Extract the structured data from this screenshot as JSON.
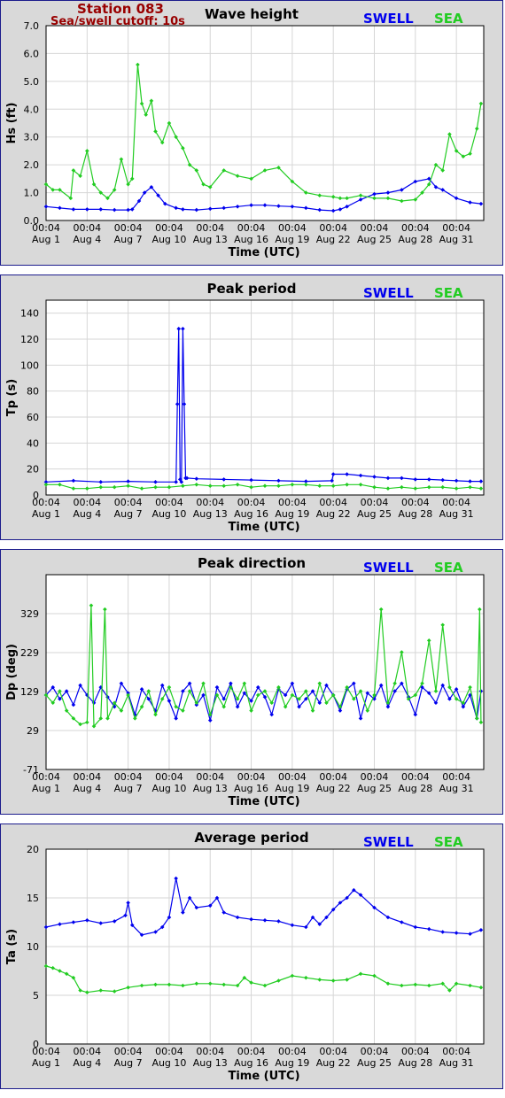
{
  "header": {
    "station": "Station 083",
    "cutoff": "Sea/swell cutoff: 10s"
  },
  "colors": {
    "swell": "#0000ee",
    "sea": "#22cc22",
    "header": "#990000",
    "frame": "#1c1c8c"
  },
  "legend": {
    "swell": "SWELL",
    "sea": "SEA"
  },
  "chart_data": [
    {
      "type": "line",
      "title": "Wave height",
      "xlabel": "Time (UTC)",
      "ylabel": "Hs (ft)",
      "xtick_time": "00:04",
      "xtick_dates": [
        "Aug 1",
        "Aug 4",
        "Aug 7",
        "Aug 10",
        "Aug 13",
        "Aug 16",
        "Aug 19",
        "Aug 22",
        "Aug 25",
        "Aug 28",
        "Aug 31"
      ],
      "yticks": [
        "0.0",
        "1.0",
        "2.0",
        "3.0",
        "4.0",
        "5.0",
        "6.0",
        "7.0"
      ],
      "ylim": [
        0,
        7
      ],
      "xlim": [
        1,
        33
      ],
      "grid": true,
      "legend": "top-right",
      "series": [
        {
          "name": "SWELL",
          "x": [
            1,
            2,
            3,
            4,
            5,
            6,
            7,
            7.3,
            7.8,
            8.2,
            8.7,
            9.2,
            9.7,
            10.5,
            11,
            12,
            13,
            14,
            15,
            16,
            17,
            18,
            19,
            20,
            21,
            22,
            22.5,
            23,
            24,
            25,
            26,
            27,
            28,
            29,
            29.5,
            30,
            31,
            32,
            32.8
          ],
          "y": [
            0.5,
            0.45,
            0.4,
            0.4,
            0.4,
            0.38,
            0.38,
            0.4,
            0.7,
            1.0,
            1.2,
            0.9,
            0.6,
            0.45,
            0.4,
            0.38,
            0.42,
            0.45,
            0.5,
            0.55,
            0.55,
            0.52,
            0.5,
            0.45,
            0.38,
            0.35,
            0.4,
            0.5,
            0.75,
            0.95,
            1.0,
            1.1,
            1.4,
            1.5,
            1.2,
            1.1,
            0.8,
            0.65,
            0.6
          ]
        },
        {
          "name": "SEA",
          "x": [
            1,
            1.5,
            2,
            2.8,
            3,
            3.5,
            4,
            4.5,
            5,
            5.5,
            6,
            6.5,
            7,
            7.3,
            7.7,
            8,
            8.3,
            8.7,
            9,
            9.5,
            10,
            10.5,
            11,
            11.5,
            12,
            12.5,
            13,
            14,
            15,
            16,
            17,
            18,
            19,
            20,
            21,
            22,
            22.5,
            23,
            24,
            25,
            26,
            27,
            28,
            28.5,
            29,
            29.5,
            30,
            30.5,
            31,
            31.5,
            32,
            32.5,
            32.8
          ],
          "y": [
            1.3,
            1.1,
            1.1,
            0.8,
            1.8,
            1.6,
            2.5,
            1.3,
            1.0,
            0.8,
            1.1,
            2.2,
            1.3,
            1.5,
            5.6,
            4.2,
            3.8,
            4.3,
            3.2,
            2.8,
            3.5,
            3.0,
            2.6,
            2.0,
            1.8,
            1.3,
            1.2,
            1.8,
            1.6,
            1.5,
            1.8,
            1.9,
            1.4,
            1.0,
            0.9,
            0.85,
            0.8,
            0.8,
            0.9,
            0.8,
            0.8,
            0.7,
            0.75,
            1.0,
            1.3,
            2.0,
            1.8,
            3.1,
            2.5,
            2.3,
            2.4,
            3.3,
            4.2
          ]
        }
      ]
    },
    {
      "type": "line",
      "title": "Peak period",
      "xlabel": "Time (UTC)",
      "ylabel": "Tp (s)",
      "xtick_time": "00:04",
      "xtick_dates": [
        "Aug 1",
        "Aug 4",
        "Aug 7",
        "Aug 10",
        "Aug 13",
        "Aug 16",
        "Aug 19",
        "Aug 22",
        "Aug 25",
        "Aug 28",
        "Aug 31"
      ],
      "yticks": [
        "0",
        "20",
        "40",
        "60",
        "80",
        "100",
        "120",
        "140"
      ],
      "ylim": [
        0,
        150
      ],
      "xlim": [
        1,
        33
      ],
      "grid": true,
      "legend": "top-right",
      "series": [
        {
          "name": "SWELL",
          "x": [
            1,
            3,
            5,
            7,
            9,
            10.5,
            10.6,
            10.7,
            10.8,
            10.9,
            11.0,
            11.1,
            11.2,
            11.3,
            12,
            14,
            16,
            18,
            20,
            21.9,
            22,
            23,
            24,
            25,
            26,
            27,
            28,
            29,
            30,
            31,
            32,
            32.8
          ],
          "y": [
            10,
            11,
            10,
            10.5,
            10,
            10,
            70,
            128,
            12,
            10,
            128,
            70,
            13,
            13,
            12.5,
            12,
            11.5,
            11,
            10.5,
            11,
            16,
            16,
            15,
            14,
            13,
            13,
            12,
            12,
            11.5,
            11,
            10.5,
            10.5
          ]
        },
        {
          "name": "SEA",
          "x": [
            1,
            2,
            3,
            4,
            5,
            6,
            7,
            8,
            9,
            10,
            11,
            12,
            13,
            14,
            15,
            16,
            17,
            18,
            19,
            20,
            21,
            22,
            23,
            24,
            25,
            26,
            27,
            28,
            29,
            30,
            31,
            32,
            32.8
          ],
          "y": [
            8,
            8,
            5,
            5,
            6,
            6,
            7,
            5,
            6,
            6,
            7,
            8,
            7,
            7,
            8,
            6,
            7,
            7,
            8,
            8,
            7,
            7,
            8,
            8,
            6,
            5,
            6,
            5,
            6,
            6,
            5,
            6,
            5
          ]
        }
      ]
    },
    {
      "type": "line",
      "title": "Peak direction",
      "xlabel": "Time (UTC)",
      "ylabel": "Dp (deg)",
      "xtick_time": "00:04",
      "xtick_dates": [
        "Aug 1",
        "Aug 4",
        "Aug 7",
        "Aug 10",
        "Aug 13",
        "Aug 16",
        "Aug 19",
        "Aug 22",
        "Aug 25",
        "Aug 28",
        "Aug 31"
      ],
      "yticks": [
        "-71",
        "29",
        "129",
        "229",
        "329"
      ],
      "ylim": [
        -71,
        429
      ],
      "xlim": [
        1,
        33
      ],
      "grid": true,
      "legend": "top-right",
      "series": [
        {
          "name": "SWELL",
          "x": [
            1,
            1.5,
            2,
            2.5,
            3,
            3.5,
            4,
            4.5,
            5,
            5.5,
            6,
            6.5,
            7,
            7.5,
            8,
            8.5,
            9,
            9.5,
            10,
            10.5,
            11,
            11.5,
            12,
            12.5,
            13,
            13.5,
            14,
            14.5,
            15,
            15.5,
            16,
            16.5,
            17,
            17.5,
            18,
            18.5,
            19,
            19.5,
            20,
            20.5,
            21,
            21.5,
            22,
            22.5,
            23,
            23.5,
            24,
            24.5,
            25,
            25.5,
            26,
            26.5,
            27,
            27.5,
            28,
            28.5,
            29,
            29.5,
            30,
            30.5,
            31,
            31.5,
            32,
            32.5,
            32.8
          ],
          "y": [
            120,
            140,
            110,
            130,
            95,
            145,
            120,
            100,
            140,
            115,
            90,
            150,
            125,
            70,
            135,
            110,
            80,
            145,
            105,
            60,
            130,
            150,
            95,
            120,
            55,
            140,
            110,
            150,
            90,
            125,
            105,
            140,
            115,
            70,
            135,
            120,
            150,
            90,
            110,
            130,
            100,
            145,
            120,
            80,
            135,
            150,
            60,
            125,
            110,
            145,
            90,
            130,
            150,
            115,
            70,
            140,
            125,
            100,
            145,
            110,
            135,
            90,
            120,
            60,
            130
          ]
        },
        {
          "name": "SEA",
          "x": [
            1,
            1.5,
            2,
            2.5,
            3,
            3.5,
            4,
            4.3,
            4.5,
            5,
            5.3,
            5.5,
            6,
            6.5,
            7,
            7.5,
            8,
            8.5,
            9,
            9.5,
            10,
            10.5,
            11,
            11.5,
            12,
            12.5,
            13,
            13.5,
            14,
            14.5,
            15,
            15.5,
            16,
            16.5,
            17,
            17.5,
            18,
            18.5,
            19,
            19.5,
            20,
            20.5,
            21,
            21.5,
            22,
            22.5,
            23,
            23.5,
            24,
            24.5,
            25,
            25.5,
            26,
            26.5,
            27,
            27.5,
            28,
            28.5,
            29,
            29.5,
            30,
            30.5,
            31,
            31.5,
            32,
            32.5,
            32.7,
            32.8
          ],
          "y": [
            120,
            100,
            130,
            80,
            60,
            45,
            50,
            350,
            40,
            60,
            340,
            60,
            100,
            80,
            120,
            60,
            90,
            130,
            70,
            110,
            140,
            90,
            80,
            130,
            100,
            150,
            70,
            120,
            90,
            140,
            110,
            150,
            80,
            120,
            130,
            100,
            140,
            90,
            120,
            110,
            130,
            80,
            150,
            100,
            120,
            90,
            140,
            110,
            130,
            80,
            120,
            340,
            100,
            150,
            230,
            110,
            120,
            150,
            260,
            130,
            300,
            140,
            110,
            100,
            140,
            60,
            340,
            50
          ]
        }
      ]
    },
    {
      "type": "line",
      "title": "Average period",
      "xlabel": "Time (UTC)",
      "ylabel": "Ta (s)",
      "xtick_time": "00:04",
      "xtick_dates": [
        "Aug 1",
        "Aug 4",
        "Aug 7",
        "Aug 10",
        "Aug 13",
        "Aug 16",
        "Aug 19",
        "Aug 22",
        "Aug 25",
        "Aug 28",
        "Aug 31"
      ],
      "yticks": [
        "0",
        "5",
        "10",
        "15",
        "20"
      ],
      "ylim": [
        0,
        20
      ],
      "xlim": [
        1,
        33
      ],
      "grid": true,
      "legend": "top-right",
      "series": [
        {
          "name": "SWELL",
          "x": [
            1,
            2,
            3,
            4,
            5,
            6,
            6.8,
            7,
            7.3,
            8,
            9,
            9.5,
            10,
            10.5,
            11,
            11.5,
            12,
            13,
            13.5,
            14,
            15,
            16,
            17,
            18,
            19,
            20,
            20.5,
            21,
            21.5,
            22,
            22.5,
            23,
            23.5,
            24,
            25,
            26,
            27,
            28,
            29,
            30,
            31,
            32,
            32.8
          ],
          "y": [
            12,
            12.3,
            12.5,
            12.7,
            12.4,
            12.6,
            13.2,
            14.5,
            12.2,
            11.2,
            11.5,
            12,
            13,
            17,
            13.5,
            15,
            14,
            14.2,
            15,
            13.5,
            13,
            12.8,
            12.7,
            12.6,
            12.2,
            12,
            13,
            12.3,
            13,
            13.8,
            14.5,
            15,
            15.8,
            15.3,
            14,
            13,
            12.5,
            12,
            11.8,
            11.5,
            11.4,
            11.3,
            11.7
          ]
        },
        {
          "name": "SEA",
          "x": [
            1,
            1.5,
            2,
            2.5,
            3,
            3.5,
            4,
            5,
            6,
            7,
            8,
            9,
            10,
            11,
            12,
            13,
            14,
            15,
            15.5,
            16,
            17,
            18,
            19,
            20,
            21,
            22,
            23,
            24,
            25,
            26,
            27,
            28,
            29,
            30,
            30.5,
            31,
            32,
            32.8
          ],
          "y": [
            8,
            7.8,
            7.5,
            7.2,
            6.8,
            5.5,
            5.3,
            5.5,
            5.4,
            5.8,
            6,
            6.1,
            6.1,
            6,
            6.2,
            6.2,
            6.1,
            6,
            6.8,
            6.3,
            6,
            6.5,
            7,
            6.8,
            6.6,
            6.5,
            6.6,
            7.2,
            7,
            6.2,
            6,
            6.1,
            6,
            6.2,
            5.5,
            6.2,
            6,
            5.8
          ]
        }
      ]
    }
  ]
}
